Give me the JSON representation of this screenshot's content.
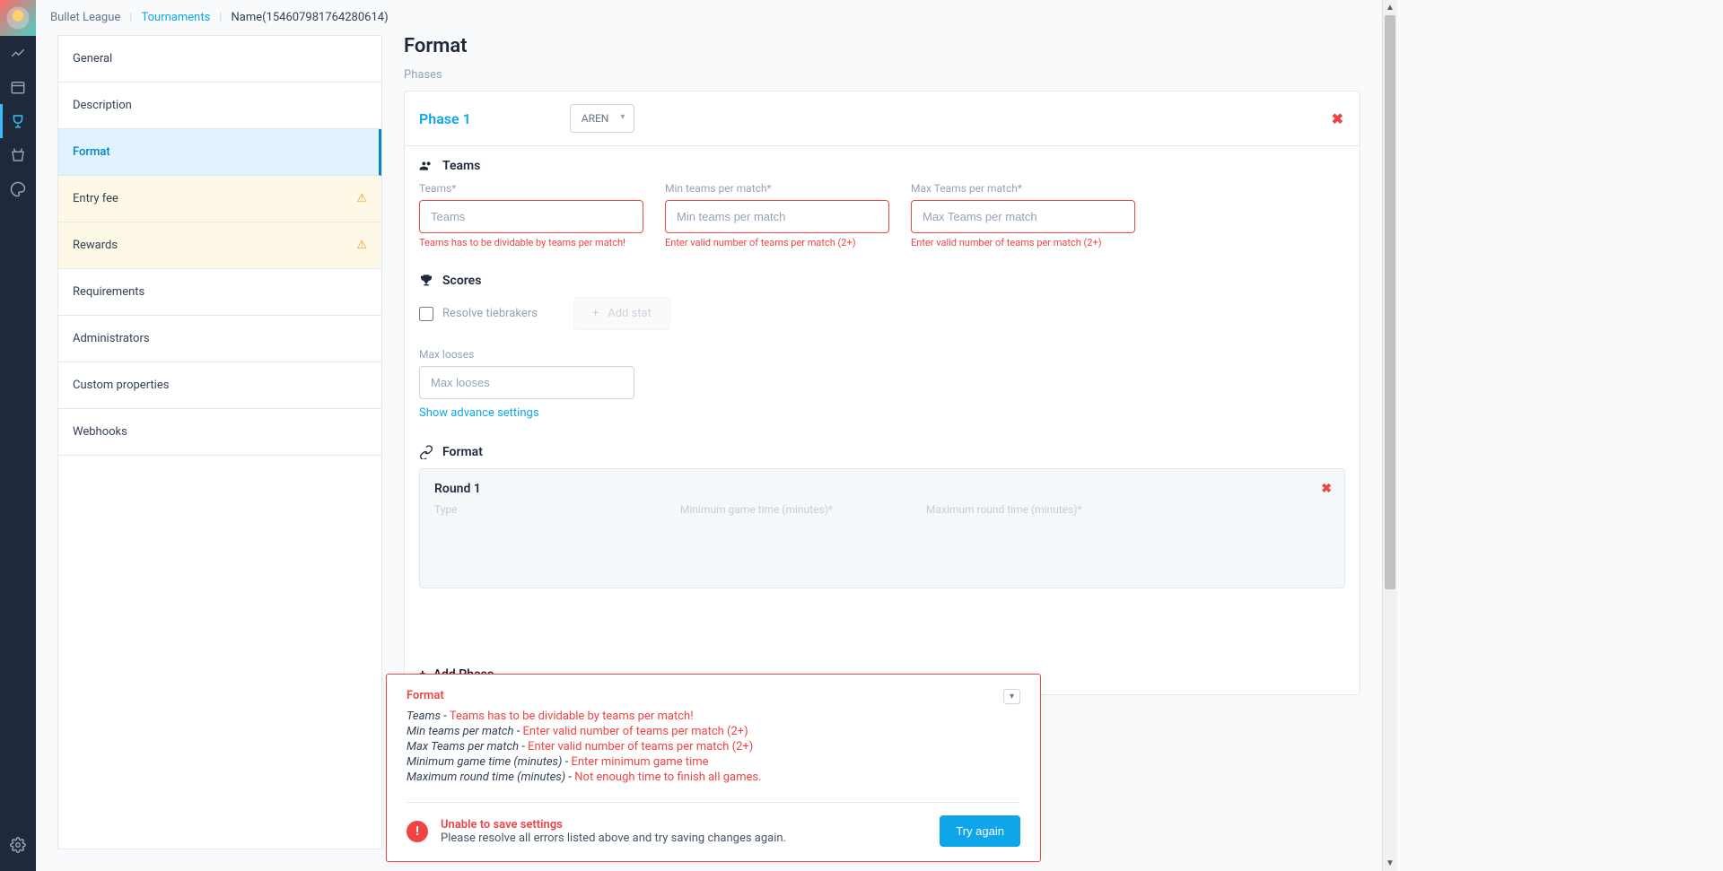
{
  "breadcrumb": {
    "game": "Bullet League",
    "section": "Tournaments",
    "name": "Name(154607981764280614)"
  },
  "sidebar": {
    "items": [
      {
        "label": "General",
        "warn": false
      },
      {
        "label": "Description",
        "warn": false
      },
      {
        "label": "Format",
        "warn": false,
        "active": true
      },
      {
        "label": "Entry fee",
        "warn": true
      },
      {
        "label": "Rewards",
        "warn": true
      },
      {
        "label": "Requirements",
        "warn": false
      },
      {
        "label": "Administrators",
        "warn": false
      },
      {
        "label": "Custom properties",
        "warn": false
      },
      {
        "label": "Webhooks",
        "warn": false
      }
    ]
  },
  "panel": {
    "title": "Format",
    "phases_label": "Phases"
  },
  "phase": {
    "title": "Phase 1",
    "type_label": "AREN",
    "teams_section": "Teams",
    "fields": {
      "teams": {
        "label": "Teams*",
        "placeholder": "Teams",
        "error": "Teams has to be dividable by teams per match!"
      },
      "min": {
        "label": "Min teams per match*",
        "placeholder": "Min teams per match",
        "error": "Enter valid number of teams per match (2+)"
      },
      "max": {
        "label": "Max Teams per match*",
        "placeholder": "Max Teams per match",
        "error": "Enter valid number of teams per match (2+)"
      }
    },
    "scores_section": "Scores",
    "resolve_tb": "Resolve tiebrakers",
    "add_stat": "Add stat",
    "max_looses": {
      "label": "Max looses",
      "placeholder": "Max looses"
    },
    "show_advanced": "Show advance settings",
    "format_section": "Format",
    "round": {
      "title": "Round 1",
      "type": "Type",
      "min_game": "Minimum game time (minutes)*",
      "max_round": "Maximum round time (minutes)*"
    },
    "add_phase": "Add Phase"
  },
  "error_panel": {
    "title": "Format",
    "lines": [
      {
        "field": "Teams",
        "msg": "Teams has to be dividable by teams per match!"
      },
      {
        "field": "Min teams per match",
        "msg": "Enter valid number of teams per match (2+)"
      },
      {
        "field": "Max Teams per match",
        "msg": "Enter valid number of teams per match (2+)"
      },
      {
        "field": "Minimum game time (minutes)",
        "msg": "Enter minimum game time"
      },
      {
        "field": "Maximum round time (minutes)",
        "msg": "Not enough time to finish all games."
      }
    ],
    "unable": "Unable to save settings",
    "desc": "Please resolve all errors listed above and try saving changes again.",
    "try_again": "Try again"
  }
}
